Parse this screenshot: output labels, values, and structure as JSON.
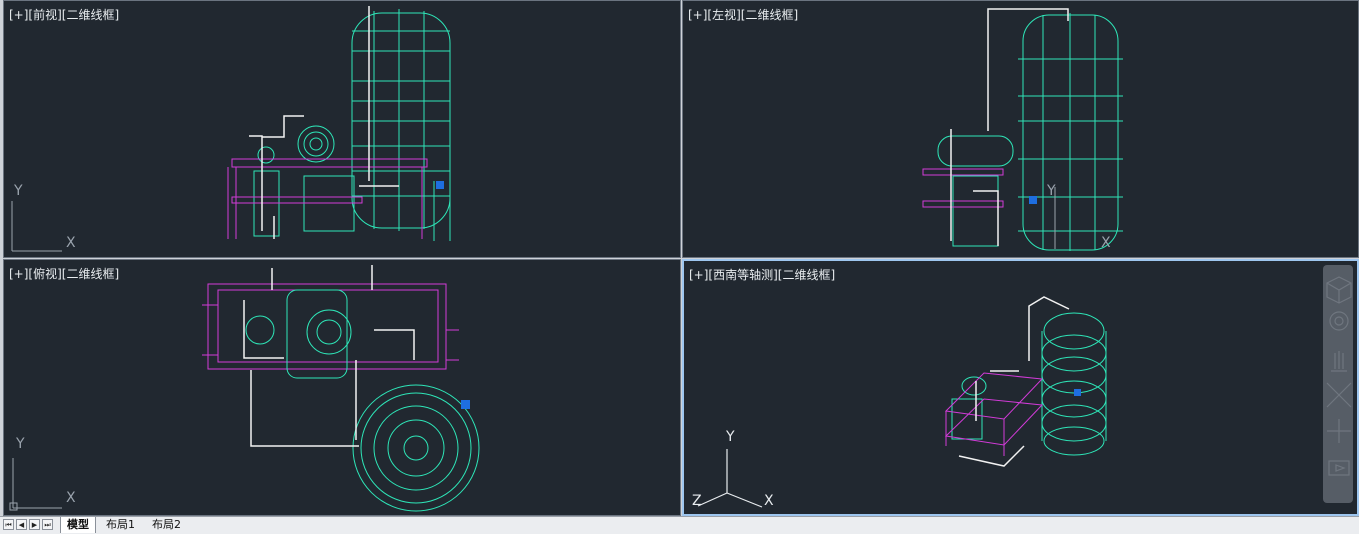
{
  "viewports": {
    "front": {
      "label": "[+][前视][二维线框]"
    },
    "left": {
      "label": "[+][左视][二维线框]"
    },
    "top": {
      "label": "[+][俯视][二维线框]"
    },
    "iso": {
      "label": "[+][西南等轴测][二维线框]"
    }
  },
  "axis": {
    "x": "X",
    "y": "Y",
    "z": "Z"
  },
  "layout_tabs": [
    {
      "label": "模型",
      "active": true
    },
    {
      "label": "布局1",
      "active": false
    },
    {
      "label": "布局2",
      "active": false
    }
  ],
  "colors": {
    "cyan": "#2ee6b8",
    "magenta": "#d23bd8",
    "white": "#f2f2f2",
    "blue": "#1e6ee0",
    "background": "#212830"
  }
}
